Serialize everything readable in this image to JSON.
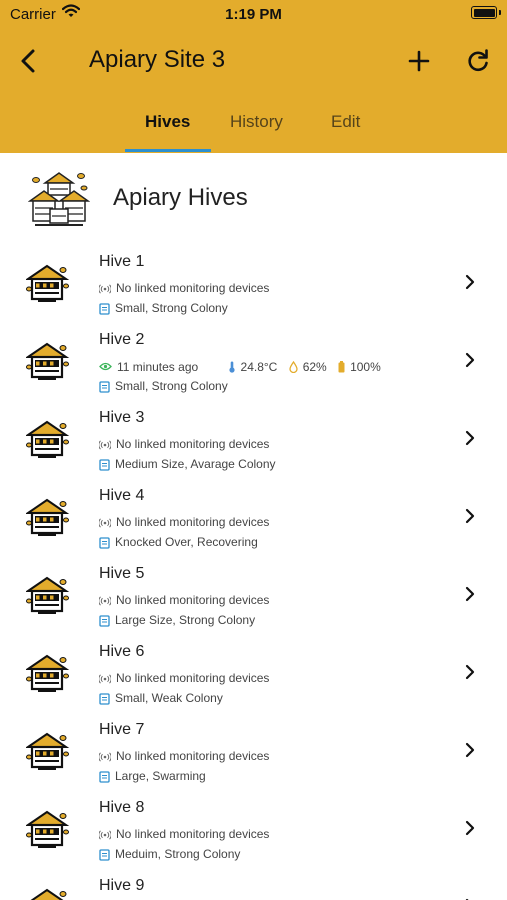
{
  "status_bar": {
    "carrier": "Carrier",
    "time": "1:19 PM"
  },
  "nav": {
    "title": "Apiary Site 3"
  },
  "tabs": [
    {
      "label": "Hives",
      "active": true
    },
    {
      "label": "History",
      "active": false
    },
    {
      "label": "Edit",
      "active": false
    }
  ],
  "section": {
    "title": "Apiary Hives"
  },
  "colors": {
    "header": "#e3ac2c",
    "tab_indicator": "#2d8fce"
  },
  "hives": [
    {
      "name": "Hive 1",
      "monitor": "No linked monitoring devices",
      "note": "Small, Strong Colony"
    },
    {
      "name": "Hive 2",
      "last_seen": "11 minutes ago",
      "temperature": "24.8°C",
      "humidity": "62%",
      "battery": "100%",
      "note": "Small, Strong Colony"
    },
    {
      "name": "Hive 3",
      "monitor": "No linked monitoring devices",
      "note": "Medium Size, Avarage Colony"
    },
    {
      "name": "Hive 4",
      "monitor": "No linked monitoring devices",
      "note": "Knocked Over, Recovering"
    },
    {
      "name": "Hive 5",
      "monitor": "No linked monitoring devices",
      "note": "Large Size, Strong Colony"
    },
    {
      "name": "Hive 6",
      "monitor": "No linked monitoring devices",
      "note": "Small, Weak Colony"
    },
    {
      "name": "Hive 7",
      "monitor": "No linked monitoring devices",
      "note": "Large, Swarming"
    },
    {
      "name": "Hive 8",
      "monitor": "No linked monitoring devices",
      "note": "Meduim, Strong Colony"
    },
    {
      "name": "Hive 9"
    }
  ]
}
